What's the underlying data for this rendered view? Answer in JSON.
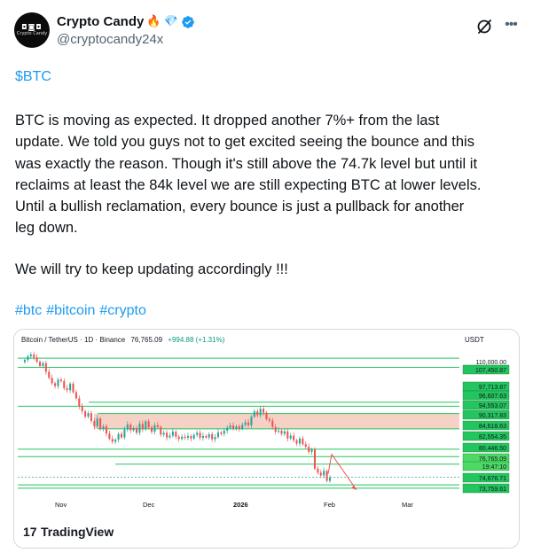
{
  "author": {
    "display_name": "Crypto Candy",
    "emoji_fire": "🔥",
    "emoji_gem": "💎",
    "handle": "@cryptocandy24x",
    "avatar_caption": "Crypto Candy",
    "verified": true,
    "verified_color": "#1d9bf0"
  },
  "header_actions": {
    "grok_icon": "grok-slash-icon",
    "more_icon": "more-horizontal-icon"
  },
  "post": {
    "cashtag": "$BTC",
    "body": "BTC is moving as expected. It dropped another 7%+ from the last\nupdate. We told you guys not to get excited seeing the bounce and this\nwas exactly the reason. Though it's still above the 74.7k level but until it\nreclaims at least the 84k level we are still expecting BTC at lower levels.\nUntil a bullish reclamation, every bounce is just a pullback for another\nleg down.",
    "follow_up": "We will try to keep updating accordingly !!!",
    "hashtags": [
      "#btc",
      "#bitcoin",
      "#crypto"
    ],
    "link_color": "#1d9bf0"
  },
  "chart": {
    "header": "Bitcoin / TetherUS · 1D · Binance",
    "last_price": "76,765.09",
    "change": "+994.88 (+1.31%)",
    "currency": "USDT",
    "watermark": "TradingView",
    "watermark_logo": "17",
    "up_color": "#26a69a",
    "down_color": "#ef5350",
    "level_color": "#22c55e",
    "resistance_zone_color": "#f4c6b8"
  },
  "chart_data": {
    "type": "candlestick",
    "title": "Bitcoin / TetherUS · 1D · Binance",
    "x_tick_labels": [
      "Nov",
      "Dec",
      "2026",
      "Feb",
      "Mar"
    ],
    "y_unit": "USDT",
    "price_labels": [
      "110,000.00",
      "107,450.87",
      "97,713.87",
      "96,607.63",
      "94,553.07",
      "90,317.83",
      "84,618.63",
      "82,554.35",
      "80,446.50",
      "76,765.09",
      "19:47:10",
      "74,676.71",
      "73,759.61"
    ],
    "horizontal_levels": [
      110000,
      107450.87,
      97713.87,
      96607.63,
      94553.07,
      90317.83,
      84618.63,
      82554.35,
      80446.5,
      74676.71,
      73759.61
    ],
    "resistance_zone": [
      90317.83,
      94553.07
    ],
    "current_price": 76765.09,
    "projection": "down-arrow below 74.7k",
    "ylim": [
      72000,
      112500
    ],
    "candle_closes": [
      109500,
      110500,
      111000,
      110200,
      109000,
      107800,
      108600,
      106200,
      104500,
      103000,
      102200,
      104000,
      103600,
      101600,
      101100,
      102900,
      100500,
      98800,
      96500,
      95200,
      93700,
      94700,
      92500,
      91000,
      93200,
      90300,
      91000,
      89000,
      87500,
      86700,
      87300,
      88900,
      87900,
      90100,
      91500,
      89900,
      90500,
      89200,
      91700,
      90200,
      92400,
      90700,
      89500,
      91300,
      90800,
      88700,
      89200,
      87900,
      88400,
      89500,
      88100,
      87500,
      88100,
      87800,
      88300,
      87600,
      88600,
      89200,
      87800,
      88300,
      87900,
      88800,
      87400,
      88000,
      89300,
      88900,
      89800,
      90600,
      91200,
      90400,
      91000,
      90300,
      91400,
      92100,
      91300,
      93700,
      95200,
      94100,
      95900,
      94800,
      93000,
      92600,
      90800,
      89500,
      89800,
      88900,
      89600,
      87600,
      88400,
      87100,
      86200,
      87600,
      86000,
      85300,
      83900,
      84600,
      79200,
      78100,
      77300,
      78600,
      75800,
      76765
    ]
  }
}
